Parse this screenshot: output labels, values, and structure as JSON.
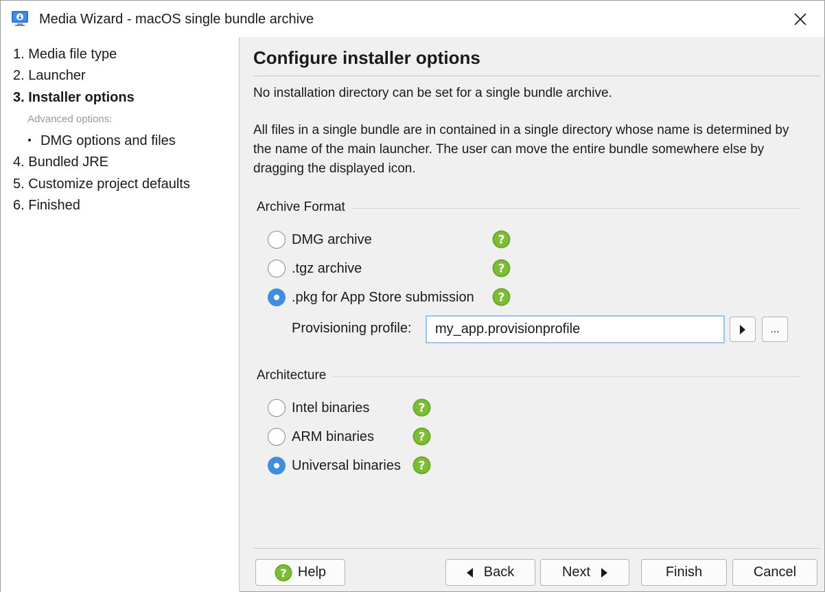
{
  "window": {
    "title": "Media Wizard - macOS single bundle archive",
    "close_label": "×"
  },
  "sidebar": {
    "steps": [
      {
        "label": "1. Media file type"
      },
      {
        "label": "2. Launcher"
      },
      {
        "label": "3. Installer options"
      },
      {
        "label": "4. Bundled JRE"
      },
      {
        "label": "5. Customize project defaults"
      },
      {
        "label": "6. Finished"
      }
    ],
    "advanced_caption": "Advanced options:",
    "sub_steps": [
      {
        "label": "DMG options and files"
      }
    ],
    "active_step": "3. Installer options"
  },
  "main": {
    "heading": "Configure installer options",
    "intro": "No installation directory can be set for a single bundle archive.",
    "description": "All files in a single bundle are in contained in a single directory whose name is determined by the name of the main launcher. The user can move the entire bundle somewhere else by dragging the displayed icon.",
    "archive_format": {
      "title": "Archive Format",
      "options": [
        {
          "label": "DMG archive",
          "checked": false
        },
        {
          "label": ".tgz archive",
          "checked": false
        },
        {
          "label": ".pkg for App Store submission",
          "checked": true
        }
      ],
      "provisioning_label": "Provisioning profile:",
      "provisioning_value": "my_app.provisionprofile",
      "browse_label": "..."
    },
    "architecture": {
      "title": "Architecture",
      "options": [
        {
          "label": "Intel binaries",
          "checked": false
        },
        {
          "label": "ARM binaries",
          "checked": false
        },
        {
          "label": "Universal binaries",
          "checked": true
        }
      ]
    }
  },
  "footer": {
    "help": "Help",
    "back": "Back",
    "next": "Next",
    "finish": "Finish",
    "cancel": "Cancel"
  },
  "colors": {
    "accent": "#3f8ee0",
    "help_icon": "#6aa82a",
    "app_icon": "#2a6fdb"
  },
  "icons": [
    "app-icon",
    "close-icon",
    "help-icon",
    "arrow-right-icon",
    "arrow-left-icon"
  ]
}
